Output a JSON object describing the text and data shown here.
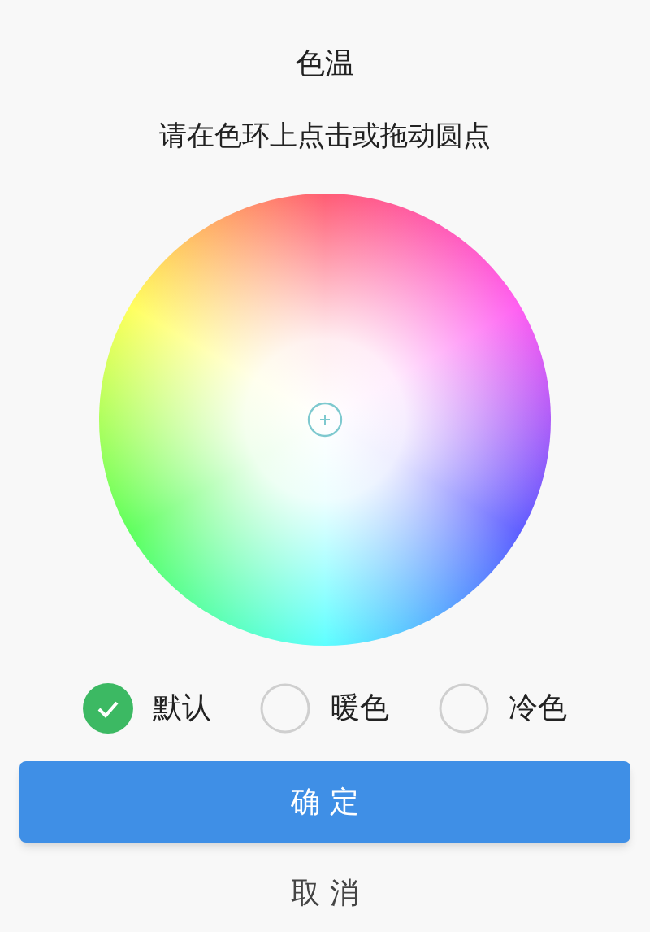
{
  "dialog": {
    "title": "色温",
    "instruction": "请在色环上点击或拖动圆点"
  },
  "options": [
    {
      "label": "默认",
      "selected": true
    },
    {
      "label": "暖色",
      "selected": false
    },
    {
      "label": "冷色",
      "selected": false
    }
  ],
  "confirm_button": "确 定",
  "cancel_button": "取 消"
}
